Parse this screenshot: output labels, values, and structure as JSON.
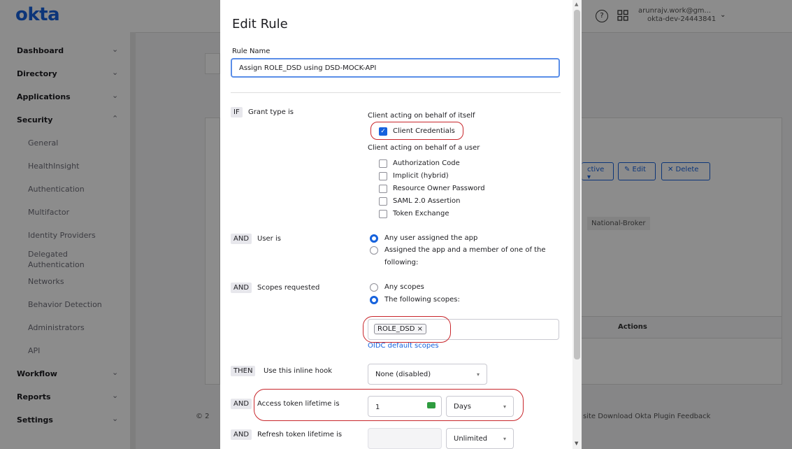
{
  "app": {
    "logo": "okta",
    "user_email": "arunrajv.work@gm...",
    "user_org": "okta-dev-24443841"
  },
  "sidebar": {
    "items": [
      {
        "label": "Dashboard",
        "level": "top",
        "chevron": "chevron-down"
      },
      {
        "label": "Directory",
        "level": "top",
        "chevron": "chevron-down"
      },
      {
        "label": "Applications",
        "level": "top",
        "chevron": "chevron-down"
      },
      {
        "label": "Security",
        "level": "top",
        "chevron": "chevron-up"
      },
      {
        "label": "General",
        "level": "sub"
      },
      {
        "label": "HealthInsight",
        "level": "sub"
      },
      {
        "label": "Authentication",
        "level": "sub"
      },
      {
        "label": "Multifactor",
        "level": "sub"
      },
      {
        "label": "Identity Providers",
        "level": "sub"
      },
      {
        "label": "Delegated",
        "label2": "Authentication",
        "level": "sub"
      },
      {
        "label": "Networks",
        "level": "sub"
      },
      {
        "label": "Behavior Detection",
        "level": "sub"
      },
      {
        "label": "Administrators",
        "level": "sub"
      },
      {
        "label": "API",
        "level": "sub"
      },
      {
        "label": "Workflow",
        "level": "top",
        "chevron": "chevron-down"
      },
      {
        "label": "Reports",
        "level": "top",
        "chevron": "chevron-down"
      },
      {
        "label": "Settings",
        "level": "top",
        "chevron": "chevron-down"
      }
    ]
  },
  "background": {
    "status_btn": "ctive ▾",
    "edit_btn": "✎ Edit",
    "delete_btn": "✕ Delete",
    "broker_label": "National-Broker",
    "actions_header": "Actions",
    "footer_links": "site   Download Okta Plugin   Feedback",
    "footer_left": "© 2"
  },
  "modal": {
    "title": "Edit Rule",
    "rule_name_label": "Rule Name",
    "rule_name_value": "Assign ROLE_DSD using DSD-MOCK-API",
    "grant": {
      "tag": "IF",
      "label": "Grant type is",
      "group1": "Client acting on behalf of itself",
      "client_credentials": "Client Credentials",
      "group2": "Client acting on behalf of a user",
      "options": [
        "Authorization Code",
        "Implicit (hybrid)",
        "Resource Owner Password",
        "SAML 2.0 Assertion",
        "Token Exchange"
      ]
    },
    "user": {
      "tag": "AND",
      "label": "User is",
      "opt1": "Any user assigned the app",
      "opt2_line1": "Assigned the app and a member of one of the",
      "opt2_line2": "following:"
    },
    "scopes": {
      "tag": "AND",
      "label": "Scopes requested",
      "opt1": "Any scopes",
      "opt2": "The following scopes:",
      "chip": "ROLE_DSD ×",
      "link": "OIDC default scopes"
    },
    "hook": {
      "tag": "THEN",
      "label": "Use this inline hook",
      "value": "None (disabled)"
    },
    "access": {
      "tag": "AND",
      "label": "Access token lifetime is",
      "value": "1",
      "unit": "Days"
    },
    "refresh": {
      "tag": "AND",
      "label": "Refresh token lifetime is",
      "unit": "Unlimited"
    }
  }
}
